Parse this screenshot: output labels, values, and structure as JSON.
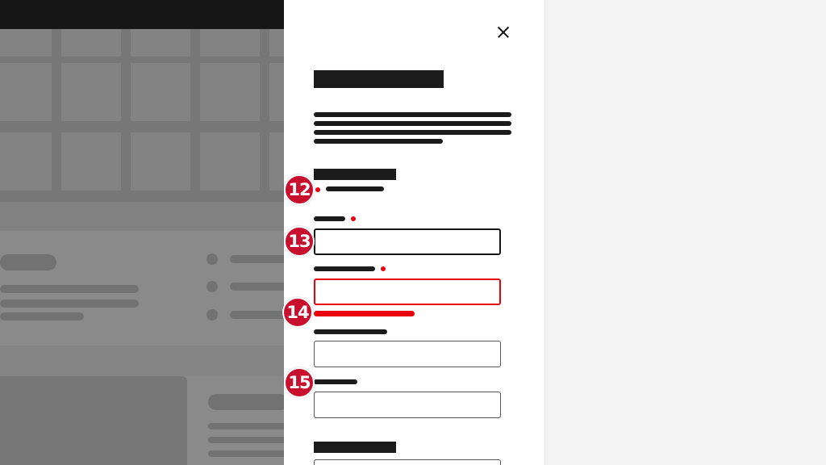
{
  "annotations": {
    "badge_12": "12",
    "badge_13": "13",
    "badge_14": "14",
    "badge_15": "15"
  },
  "colors": {
    "overlay": "#161616",
    "panel_background": "#ffffff",
    "text_placeholder": "#1b1b1b",
    "required_indicator": "#e8000d",
    "error": "#e8000d",
    "badge": "#c8102e"
  },
  "icons": {
    "close": "close-icon"
  },
  "form": {
    "fields": [
      {
        "id": "field-1",
        "state": "focused",
        "required": true
      },
      {
        "id": "field-2",
        "state": "error",
        "required": true
      },
      {
        "id": "field-3",
        "state": "default",
        "required": false
      },
      {
        "id": "field-4",
        "state": "default",
        "required": false
      }
    ]
  }
}
